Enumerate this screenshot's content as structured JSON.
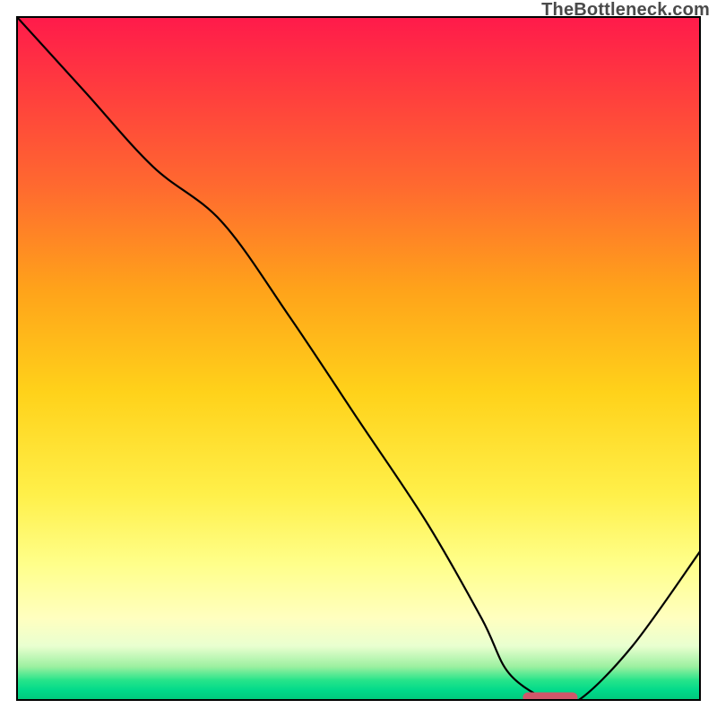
{
  "watermark": "TheBottleneck.com",
  "chart_data": {
    "type": "line",
    "title": "",
    "xlabel": "",
    "ylabel": "",
    "xlim": [
      0,
      100
    ],
    "ylim": [
      0,
      100
    ],
    "grid": false,
    "background_gradient": {
      "top": "#ff1a4b",
      "middle": "#ffd21a",
      "bottom": "#00c77a"
    },
    "series": [
      {
        "name": "bottleneck-curve",
        "color": "#000000",
        "x": [
          0,
          10,
          20,
          30,
          40,
          50,
          60,
          68,
          72,
          78,
          82,
          90,
          100
        ],
        "y": [
          100,
          89,
          78,
          70,
          56,
          41,
          26,
          12,
          4,
          0,
          0,
          8,
          22
        ]
      }
    ],
    "marker": {
      "name": "optimum-marker",
      "shape": "rounded-rect",
      "color": "#d0576a",
      "x_center": 78,
      "y": 0.5,
      "width_pct": 8,
      "height_pct": 1.5
    }
  }
}
